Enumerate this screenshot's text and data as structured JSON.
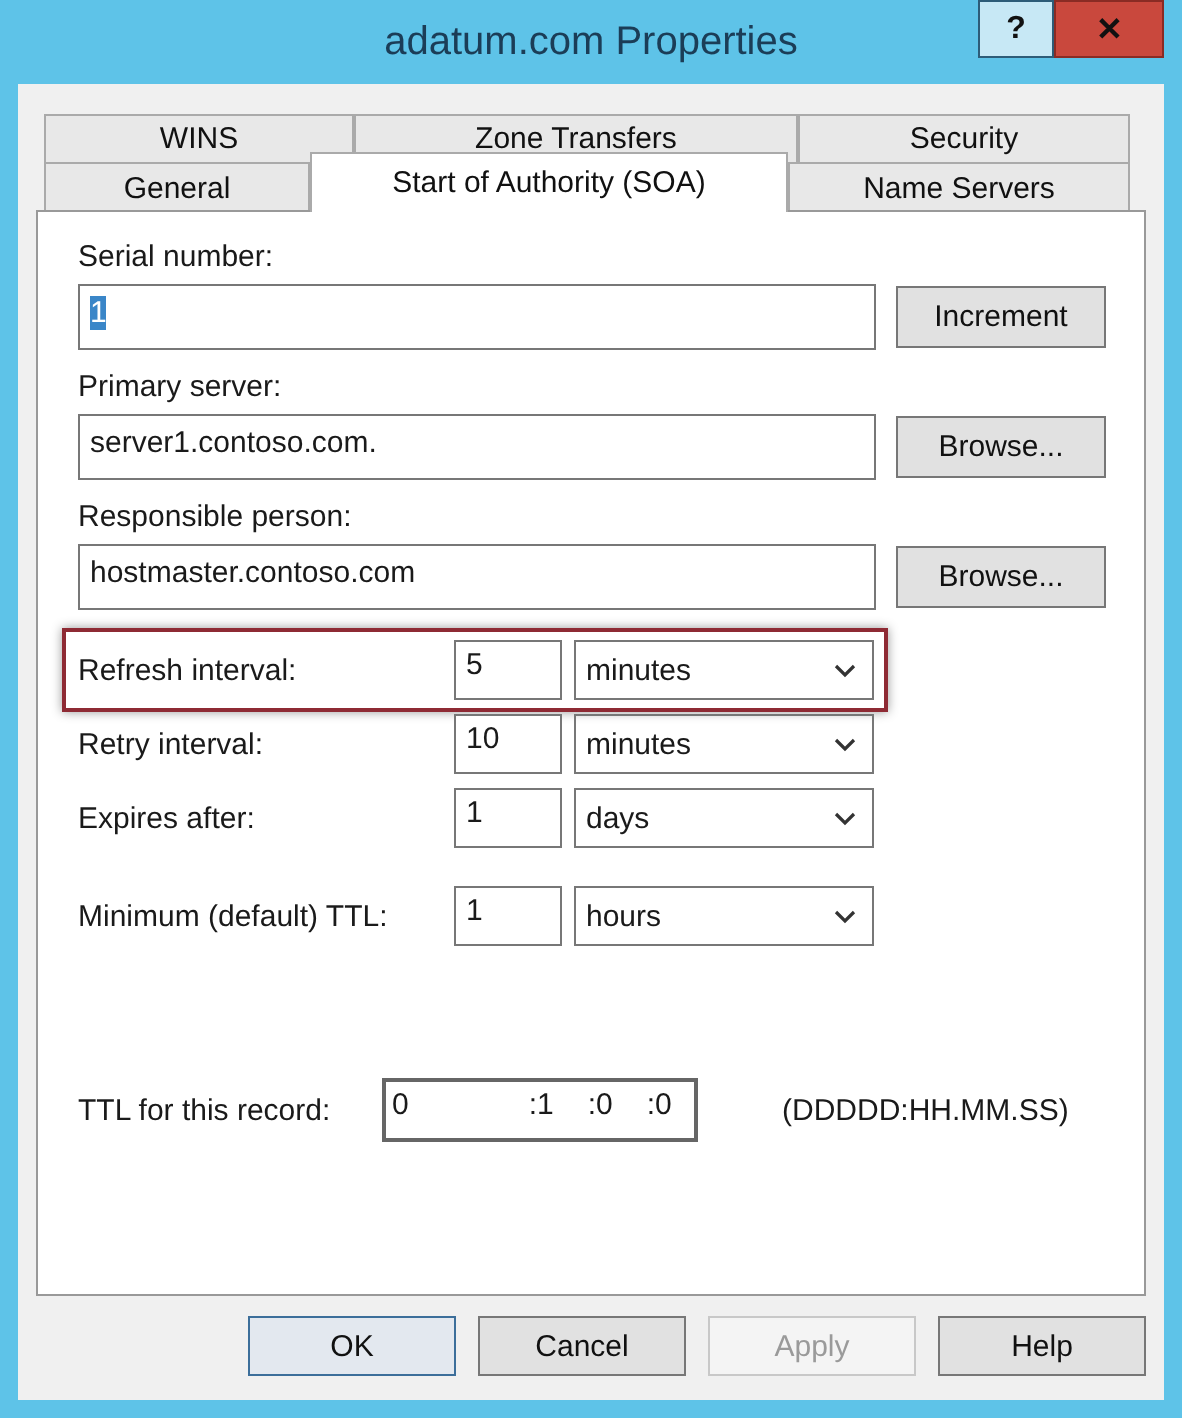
{
  "window": {
    "title": "adatum.com Properties",
    "buttons": [
      {
        "kind": "help",
        "label": "?"
      },
      {
        "kind": "close",
        "label": "✕"
      }
    ]
  },
  "tab_rows": [
    [
      {
        "label": "WINS",
        "selected": false
      },
      {
        "label": "Zone Transfers",
        "selected": false
      },
      {
        "label": "Security",
        "selected": false
      }
    ],
    [
      {
        "label": "General",
        "selected": false
      },
      {
        "label": "Start of Authority (SOA)",
        "selected": true
      },
      {
        "label": "Name Servers",
        "selected": false
      }
    ]
  ],
  "fields": [
    {
      "label": "Serial number:",
      "value": "1",
      "value_selected": true,
      "button": "Increment"
    },
    {
      "label": "Primary server:",
      "value": "server1.contoso.com.",
      "value_selected": false,
      "button": "Browse..."
    },
    {
      "label": "Responsible person:",
      "value": "hostmaster.contoso.com",
      "value_selected": false,
      "button": "Browse..."
    }
  ],
  "intervals": [
    {
      "label": "Refresh interval:",
      "value": "5",
      "unit": "minutes",
      "highlighted": true
    },
    {
      "label": "Retry interval:",
      "value": "10",
      "unit": "minutes",
      "highlighted": false
    },
    {
      "label": "Expires after:",
      "value": "1",
      "unit": "days",
      "highlighted": false
    },
    {
      "label": "Minimum (default) TTL:",
      "value": "1",
      "unit": "hours",
      "highlighted": false
    }
  ],
  "ttl": {
    "label": "TTL for this record:",
    "segments": [
      "0",
      ":1",
      ":0",
      ":0"
    ],
    "format": "(DDDDD:HH.MM.SS)"
  },
  "buttons": [
    {
      "label": "OK",
      "disabled": false,
      "default": true
    },
    {
      "label": "Cancel",
      "disabled": false,
      "default": false
    },
    {
      "label": "Apply",
      "disabled": true,
      "default": false
    },
    {
      "label": "Help",
      "disabled": false,
      "default": false
    }
  ]
}
